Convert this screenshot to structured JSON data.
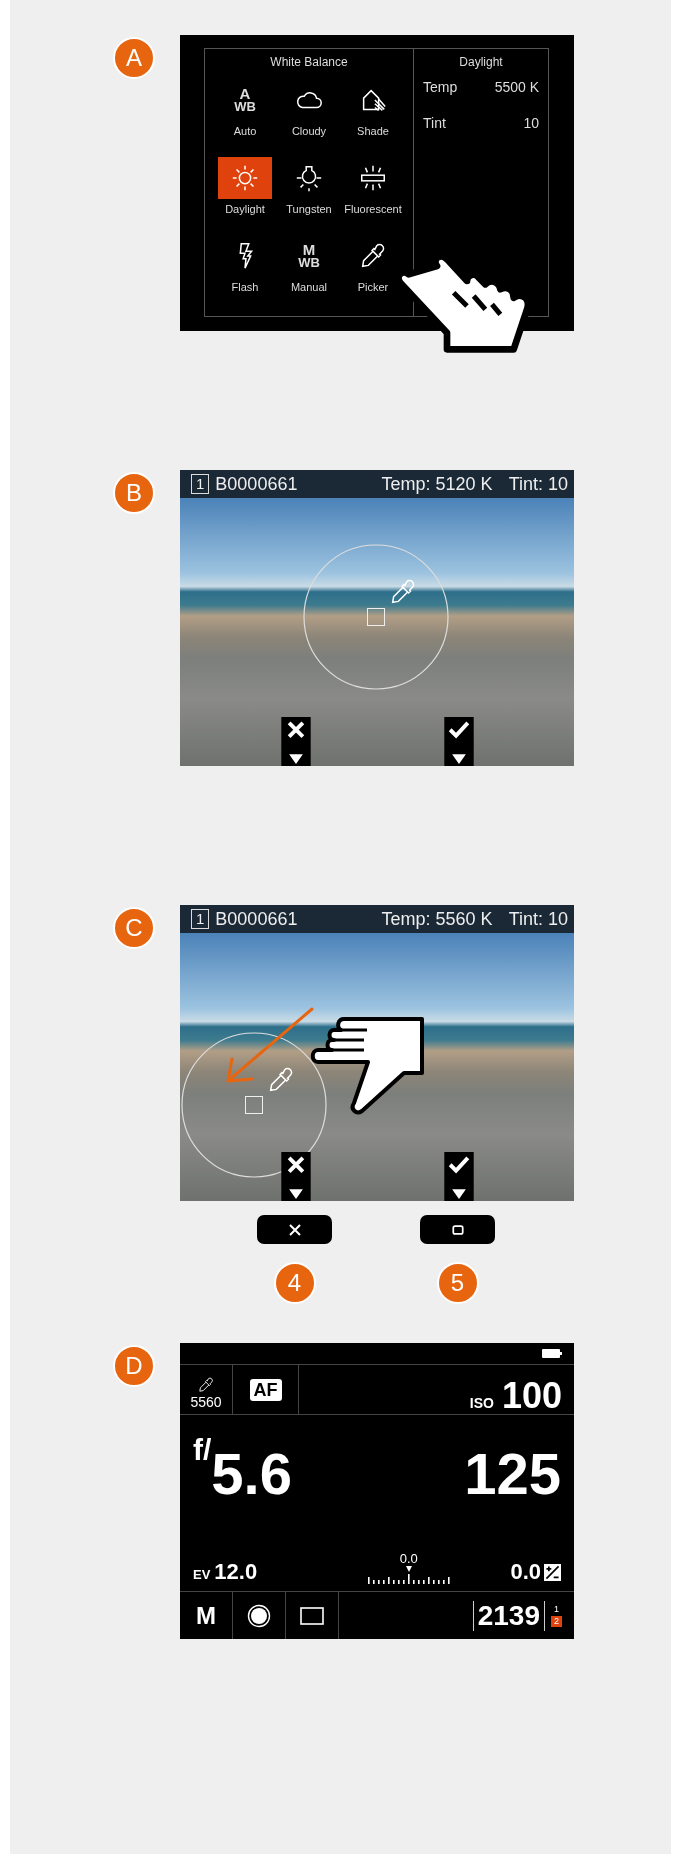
{
  "panels": [
    {
      "kind": "wb_menu",
      "badge": "A",
      "title": "White Balance",
      "presets": [
        {
          "kind": "text",
          "icon_text": "A",
          "icon_sub": "WB",
          "label": "Auto",
          "selected": false
        },
        {
          "kind": "cloudy",
          "label": "Cloudy",
          "selected": false
        },
        {
          "kind": "shade",
          "label": "Shade",
          "selected": false
        },
        {
          "kind": "daylight",
          "label": "Daylight",
          "selected": true
        },
        {
          "kind": "tungsten",
          "label": "Tungsten",
          "selected": false
        },
        {
          "kind": "fluorescent",
          "label": "Fluorescent",
          "selected": false
        },
        {
          "kind": "flash",
          "label": "Flash",
          "selected": false
        },
        {
          "kind": "text",
          "icon_text": "M",
          "icon_sub": "WB",
          "label": "Manual",
          "selected": false
        },
        {
          "kind": "picker",
          "label": "Picker",
          "selected": false
        }
      ],
      "detail": {
        "title": "Daylight",
        "rows": [
          {
            "label": "Temp",
            "value": "5500 K"
          },
          {
            "label": "Tint",
            "value": "10"
          }
        ]
      }
    },
    {
      "kind": "picker",
      "badge": "B",
      "slot": "1",
      "file": "B0000661",
      "temp": "Temp: 5120 K",
      "tint": "Tint: 10"
    },
    {
      "kind": "picker_swipe",
      "badge": "C",
      "slot": "1",
      "file": "B0000661",
      "temp": "Temp: 5560 K",
      "tint": "Tint: 10",
      "buttons": [
        {
          "kind": "cross",
          "badge": "4"
        },
        {
          "kind": "square",
          "badge": "5"
        }
      ]
    },
    {
      "kind": "status",
      "badge": "D",
      "picker_temp": "5560",
      "af": "AF",
      "iso_label": "ISO",
      "iso": "100",
      "aperture_prefix": "f/",
      "aperture": "5.6",
      "shutter": "125",
      "ev_label": "EV",
      "ev": "12.0",
      "meter_reading": "0.0",
      "comp": "0.0",
      "mode": "M",
      "shots": "2139",
      "slots": [
        {
          "label": "1",
          "selected": false
        },
        {
          "label": "2",
          "selected": true
        }
      ]
    }
  ]
}
